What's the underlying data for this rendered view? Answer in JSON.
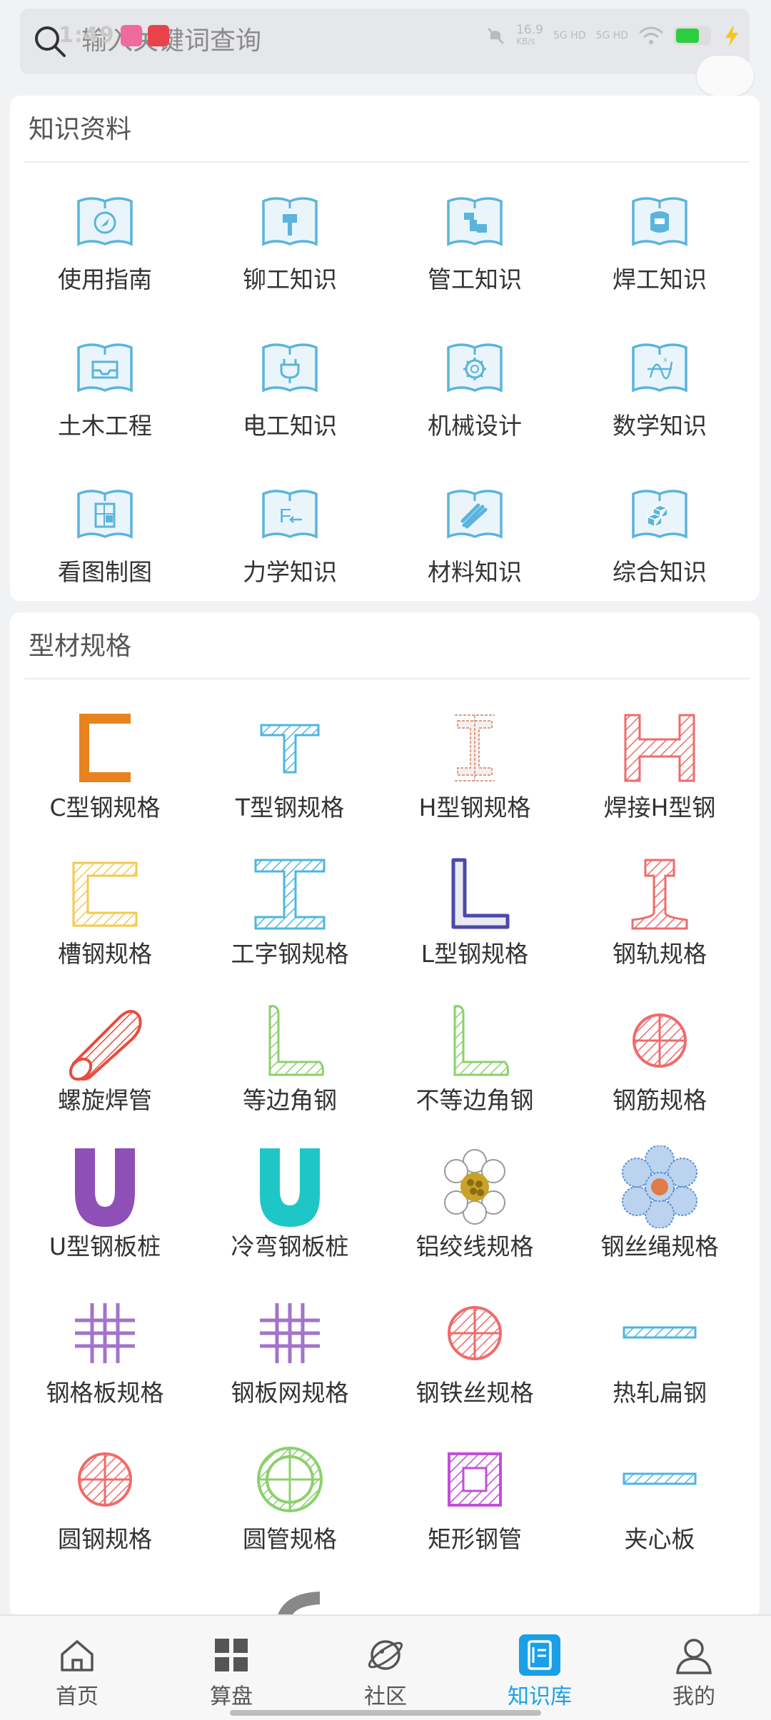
{
  "search": {
    "placeholder": "输入关键词查询"
  },
  "status": {
    "time": "1:49",
    "net_speed": "16.9",
    "net_unit": "KB/s",
    "sig1": "5G HD",
    "sig2": "5G HD"
  },
  "knowledge": {
    "title": "知识资料",
    "items": [
      {
        "label": "使用指南",
        "icon": "compass-book-icon"
      },
      {
        "label": "铆工知识",
        "icon": "rivet-book-icon"
      },
      {
        "label": "管工知识",
        "icon": "pipe-book-icon"
      },
      {
        "label": "焊工知识",
        "icon": "welding-mask-book-icon"
      },
      {
        "label": "土木工程",
        "icon": "tray-book-icon"
      },
      {
        "label": "电工知识",
        "icon": "plug-book-icon"
      },
      {
        "label": "机械设计",
        "icon": "gear-book-icon"
      },
      {
        "label": "数学知识",
        "icon": "formula-book-icon"
      },
      {
        "label": "看图制图",
        "icon": "drawing-book-icon"
      },
      {
        "label": "力学知识",
        "icon": "force-book-icon"
      },
      {
        "label": "材料知识",
        "icon": "material-book-icon"
      },
      {
        "label": "综合知识",
        "icon": "cubes-book-icon"
      }
    ]
  },
  "profiles": {
    "title": "型材规格",
    "items": [
      {
        "label": "C型钢规格",
        "icon": "c-steel-icon",
        "color": "#e8821e"
      },
      {
        "label": "T型钢规格",
        "icon": "t-steel-icon",
        "color": "#4db6e0"
      },
      {
        "label": "H型钢规格",
        "icon": "h-steel-drawing-icon",
        "color": "#d9a08a"
      },
      {
        "label": "焊接H型钢",
        "icon": "welded-h-steel-icon",
        "color": "#ef6b6b"
      },
      {
        "label": "槽钢规格",
        "icon": "channel-steel-icon",
        "color": "#f5c94a"
      },
      {
        "label": "工字钢规格",
        "icon": "i-beam-icon",
        "color": "#4db6e0"
      },
      {
        "label": "L型钢规格",
        "icon": "l-steel-icon",
        "color": "#4a4aa8"
      },
      {
        "label": "钢轨规格",
        "icon": "rail-icon",
        "color": "#ef6b6b"
      },
      {
        "label": "螺旋焊管",
        "icon": "spiral-pipe-icon",
        "color": "#e84c3d"
      },
      {
        "label": "等边角钢",
        "icon": "equal-angle-icon",
        "color": "#8bd16b"
      },
      {
        "label": "不等边角钢",
        "icon": "unequal-angle-icon",
        "color": "#8bd16b"
      },
      {
        "label": "钢筋规格",
        "icon": "rebar-icon",
        "color": "#ef6b6b"
      },
      {
        "label": "U型钢板桩",
        "icon": "u-sheet-pile-icon",
        "color": "#8e4fb6"
      },
      {
        "label": "冷弯钢板桩",
        "icon": "cold-bent-pile-icon",
        "color": "#1fc6c6"
      },
      {
        "label": "铝绞线规格",
        "icon": "aluminum-strand-icon",
        "color": "#c9a227"
      },
      {
        "label": "钢丝绳规格",
        "icon": "wire-rope-icon",
        "color": "#5b8fd6"
      },
      {
        "label": "钢格板规格",
        "icon": "steel-grating-icon",
        "color": "#a274c9"
      },
      {
        "label": "钢板网规格",
        "icon": "steel-mesh-icon",
        "color": "#a274c9"
      },
      {
        "label": "钢铁丝规格",
        "icon": "steel-wire-icon",
        "color": "#ef6b6b"
      },
      {
        "label": "热轧扁钢",
        "icon": "flat-steel-icon",
        "color": "#4db6e0"
      },
      {
        "label": "圆钢规格",
        "icon": "round-steel-icon",
        "color": "#ef6b6b"
      },
      {
        "label": "圆管规格",
        "icon": "round-pipe-icon",
        "color": "#8bd16b"
      },
      {
        "label": "矩形钢管",
        "icon": "rect-tube-icon",
        "color": "#c04fd8"
      },
      {
        "label": "夹心板",
        "icon": "sandwich-panel-icon",
        "color": "#4db6e0"
      }
    ]
  },
  "tabs": [
    {
      "label": "首页",
      "icon": "home-icon",
      "active": false
    },
    {
      "label": "算盘",
      "icon": "grid-icon",
      "active": false
    },
    {
      "label": "社区",
      "icon": "planet-icon",
      "active": false
    },
    {
      "label": "知识库",
      "icon": "book-icon",
      "active": true
    },
    {
      "label": "我的",
      "icon": "user-icon",
      "active": false
    }
  ],
  "colors": {
    "accent": "#1aa0e8",
    "book_icon": "#5ab4dd",
    "background": "#f1f2f4"
  }
}
